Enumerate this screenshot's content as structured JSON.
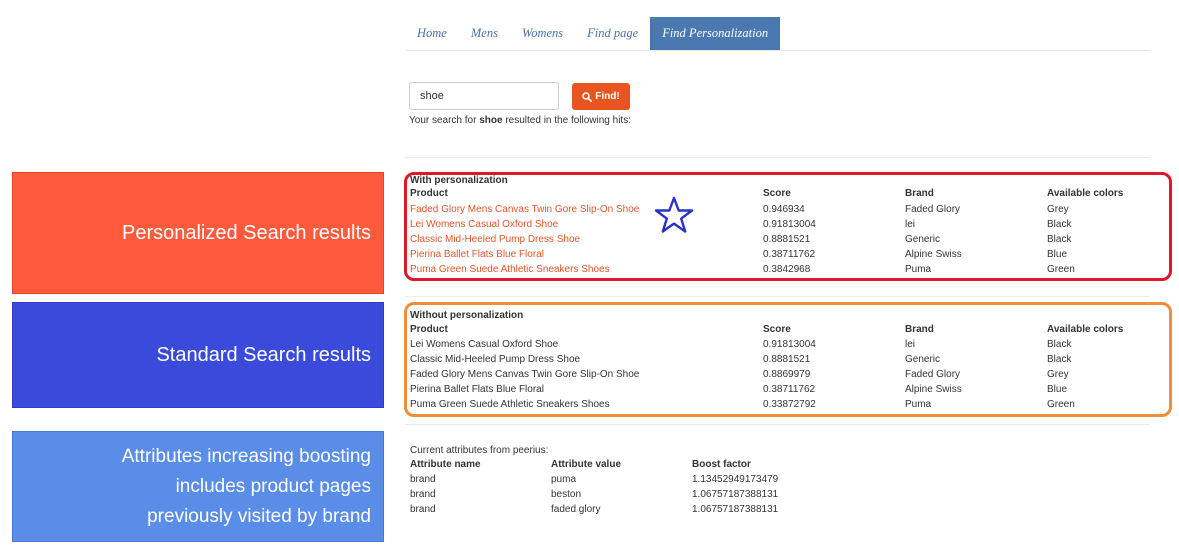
{
  "nav": {
    "items": [
      "Home",
      "Mens",
      "Womens",
      "Find page",
      "Find Personalization"
    ],
    "active_index": 4
  },
  "search": {
    "value": "shoe",
    "button_label": "Find!",
    "summary_prefix": "Your search for ",
    "summary_term": "shoe",
    "summary_suffix": " resulted in the following hits:"
  },
  "side_labels": {
    "personalized": "Personalized Search results",
    "standard": "Standard Search results",
    "attributes": "Attributes increasing boosting\nincludes product pages\npreviously visited by brand"
  },
  "personalized": {
    "title": "With personalization",
    "headers": [
      "Product",
      "Score",
      "Brand",
      "Available colors"
    ],
    "rows": [
      [
        "Faded Glory Mens Canvas Twin Gore Slip-On Shoe",
        "0.946934",
        "Faded Glory",
        "Grey"
      ],
      [
        "Lei Womens Casual Oxford Shoe",
        "0.91813004",
        "lei",
        "Black"
      ],
      [
        "Classic Mid-Heeled Pump Dress Shoe",
        "0.8881521",
        "Generic",
        "Black"
      ],
      [
        "Pierina Ballet Flats Blue Floral",
        "0.38711762",
        "Alpine Swiss",
        "Blue"
      ],
      [
        "Puma Green Suede Athletic Sneakers Shoes",
        "0.3842968",
        "Puma",
        "Green"
      ]
    ]
  },
  "standard": {
    "title": "Without personalization",
    "headers": [
      "Product",
      "Score",
      "Brand",
      "Available colors"
    ],
    "rows": [
      [
        "Lei Womens Casual Oxford Shoe",
        "0.91813004",
        "lei",
        "Black"
      ],
      [
        "Classic Mid-Heeled Pump Dress Shoe",
        "0.8881521",
        "Generic",
        "Black"
      ],
      [
        "Faded Glory Mens Canvas Twin Gore Slip-On Shoe",
        "0.8869979",
        "Faded Glory",
        "Grey"
      ],
      [
        "Pierina Ballet Flats Blue Floral",
        "0.38711762",
        "Alpine Swiss",
        "Blue"
      ],
      [
        "Puma Green Suede Athletic Sneakers Shoes",
        "0.33872792",
        "Puma",
        "Green"
      ]
    ]
  },
  "attributes": {
    "title": "Current attributes from peerius:",
    "headers": [
      "Attribute name",
      "Attribute value",
      "Boost factor"
    ],
    "rows": [
      [
        "brand",
        "puma",
        "1.13452949173479"
      ],
      [
        "brand",
        "beston",
        "1.06757187388131"
      ],
      [
        "brand",
        "faded glory",
        "1.06757187388131"
      ]
    ]
  },
  "icons": {
    "search_button": "search-icon",
    "highlight": "star-icon"
  },
  "colors": {
    "accent": "#e95420",
    "nav_active": "#4a78b0",
    "personalized_box": "#ff5a3c",
    "standard_box": "#3a4bdc",
    "attributes_box": "#5a8de8",
    "red_outline": "#e0162c",
    "orange_outline": "#f08c3a",
    "link": "#e4542a"
  }
}
